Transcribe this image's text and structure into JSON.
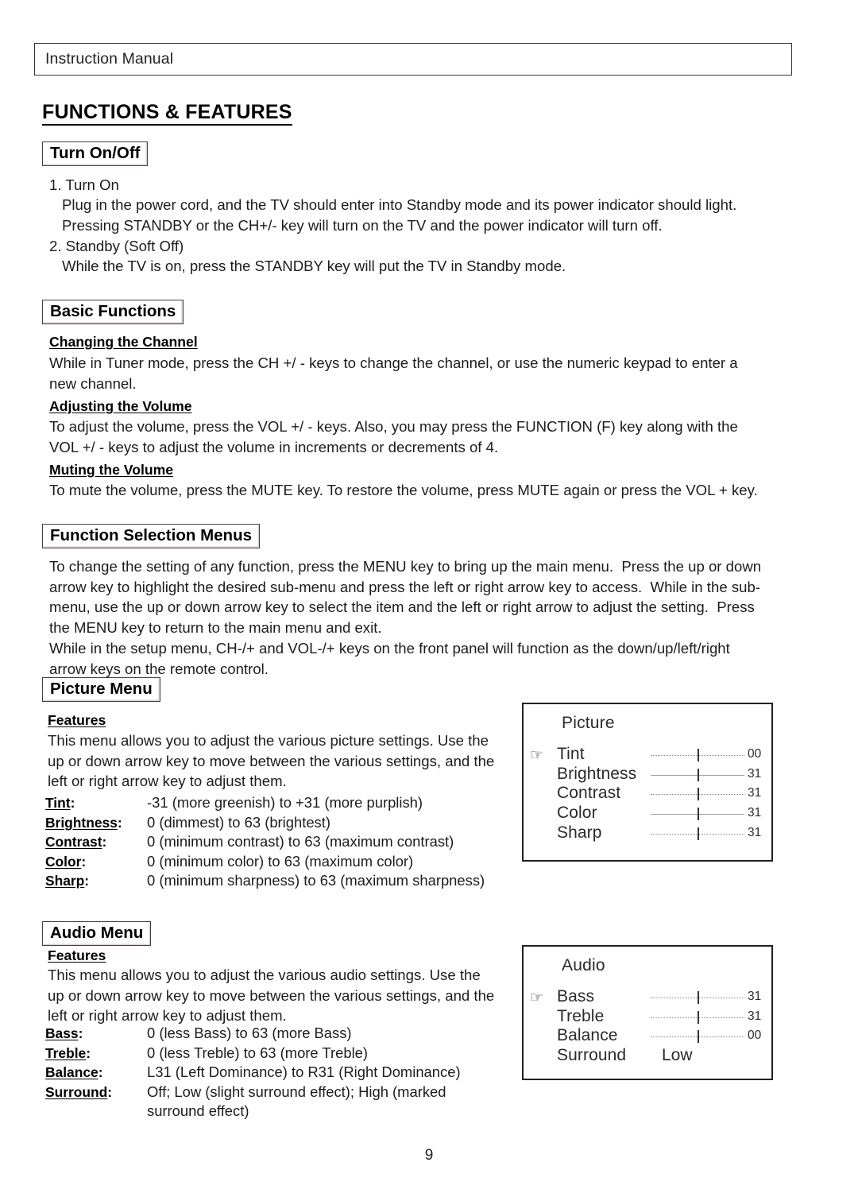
{
  "header": {
    "title": "Instruction Manual"
  },
  "page_title": "FUNCTIONS & FEATURES",
  "page_number": "9",
  "sections": {
    "turn_on_off": {
      "heading": "Turn On/Off",
      "item1_label": "1. Turn On",
      "item1_body": "Plug in the power cord, and the TV should enter into Standby mode and its power indicator should light.\nPressing STANDBY or the CH+/- key will turn on the TV and the power indicator will turn off.",
      "item2_label": "2. Standby (Soft Off)",
      "item2_body": "While the TV is on, press the STANDBY key will put the TV in Standby mode."
    },
    "basic_functions": {
      "heading": "Basic Functions",
      "sub1_title": "Changing the Channel",
      "sub1_body": "While in Tuner mode, press the CH +/ - keys to change the channel, or use the numeric keypad to enter a\nnew channel.",
      "sub2_title": "Adjusting the Volume",
      "sub2_body": "To adjust the volume, press the VOL +/ - keys. Also, you may press the FUNCTION (F) key along with the\nVOL +/ - keys to adjust the volume in increments or decrements of 4.",
      "sub3_title": "Muting the Volume",
      "sub3_body": "To mute the volume, press the MUTE key. To restore the volume, press MUTE again or press the VOL + key."
    },
    "function_selection_menus": {
      "heading": "Function Selection Menus",
      "body1": "To change the setting of any function, press the MENU key to bring up the main menu.  Press the up or down\narrow key to highlight the desired sub-menu and press the left or right arrow key to access.  While in the sub-\nmenu, use the up or down arrow key to select the item and the left or right arrow to adjust the setting.  Press\nthe MENU key to return to the main menu and exit.",
      "body2": "While in the setup menu, CH-/+ and VOL-/+ keys on the front panel will function as the down/up/left/right\narrow keys on the remote control."
    },
    "picture_menu": {
      "heading": "Picture Menu",
      "features_title": "Features",
      "features_body": "This menu allows you to adjust the various picture settings. Use the\nup or down arrow key to move between the various settings, and the\nleft or right arrow key to adjust them.",
      "definitions": [
        {
          "term": "Tint",
          "desc": "-31 (more greenish) to +31 (more purplish)"
        },
        {
          "term": "Brightness",
          "desc": "0 (dimmest) to 63 (brightest)"
        },
        {
          "term": "Contrast",
          "desc": "0 (minimum contrast) to 63 (maximum contrast)"
        },
        {
          "term": "Color",
          "desc": "0 (minimum color) to 63 (maximum color)"
        },
        {
          "term": "Sharp",
          "desc": "0 (minimum sharpness) to 63 (maximum sharpness)"
        }
      ]
    },
    "audio_menu": {
      "heading": "Audio Menu",
      "features_title": "Features",
      "features_body": "This menu allows you to adjust the various audio settings. Use the\nup or down arrow key to move between the various settings, and the\nleft or right arrow key to adjust them.",
      "definitions": [
        {
          "term": "Bass",
          "desc": "0 (less Bass) to 63 (more Bass)"
        },
        {
          "term": "Treble",
          "desc": "0 (less Treble) to 63 (more Treble)"
        },
        {
          "term": "Balance",
          "desc": "L31 (Left Dominance) to R31 (Right Dominance)"
        },
        {
          "term": "Surround",
          "desc": "Off; Low (slight surround effect); High (marked\nsurround effect)"
        }
      ]
    }
  },
  "osd": {
    "cursor_icon": "pointing-hand-icon",
    "cursor_glyph": "☞",
    "picture": {
      "title": "Picture",
      "rows": [
        {
          "label": "Tint",
          "value": "00",
          "selected": true,
          "track": "dotted",
          "thumb_pct": 50
        },
        {
          "label": "Brightness",
          "value": "31",
          "selected": false,
          "track": "solid",
          "thumb_pct": 50
        },
        {
          "label": "Contrast",
          "value": "31",
          "selected": false,
          "track": "dotted",
          "thumb_pct": 50
        },
        {
          "label": "Color",
          "value": "31",
          "selected": false,
          "track": "solid",
          "thumb_pct": 50
        },
        {
          "label": "Sharp",
          "value": "31",
          "selected": false,
          "track": "dotted",
          "thumb_pct": 50
        }
      ]
    },
    "audio": {
      "title": "Audio",
      "rows": [
        {
          "label": "Bass",
          "value": "31",
          "selected": true,
          "track": "dotted",
          "thumb_pct": 50
        },
        {
          "label": "Treble",
          "value": "31",
          "selected": false,
          "track": "dotted",
          "thumb_pct": 50
        },
        {
          "label": "Balance",
          "value": "00",
          "selected": false,
          "track": "dotted",
          "thumb_pct": 50
        }
      ],
      "text_row": {
        "label": "Surround",
        "value": "Low"
      }
    }
  }
}
